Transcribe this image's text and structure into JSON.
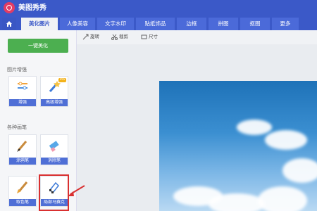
{
  "app": {
    "title": "美图秀秀"
  },
  "tabs": [
    {
      "label": "美化图片",
      "active": true
    },
    {
      "label": "人像美容"
    },
    {
      "label": "文字水印"
    },
    {
      "label": "贴纸饰品"
    },
    {
      "label": "边框"
    },
    {
      "label": "拼图"
    },
    {
      "label": "抠图"
    },
    {
      "label": "更多"
    }
  ],
  "left": {
    "one_key_label": "一键美化",
    "section_enhance": "图片增强",
    "section_brush": "各种画笔",
    "tools": [
      {
        "label": "增强"
      },
      {
        "label": "高级增强",
        "badge": "Pro"
      },
      {
        "label": "涂鸦笔"
      },
      {
        "label": "消除笔"
      },
      {
        "label": "取色笔"
      },
      {
        "label": "局部马赛克"
      }
    ]
  },
  "toolbar": {
    "rotate": "旋转",
    "crop": "裁剪",
    "size": "尺寸"
  },
  "colors": {
    "titlebar": "#3b59c8",
    "tab": "#4b6ad9",
    "green": "#4caf50",
    "highlight": "#d93030"
  }
}
